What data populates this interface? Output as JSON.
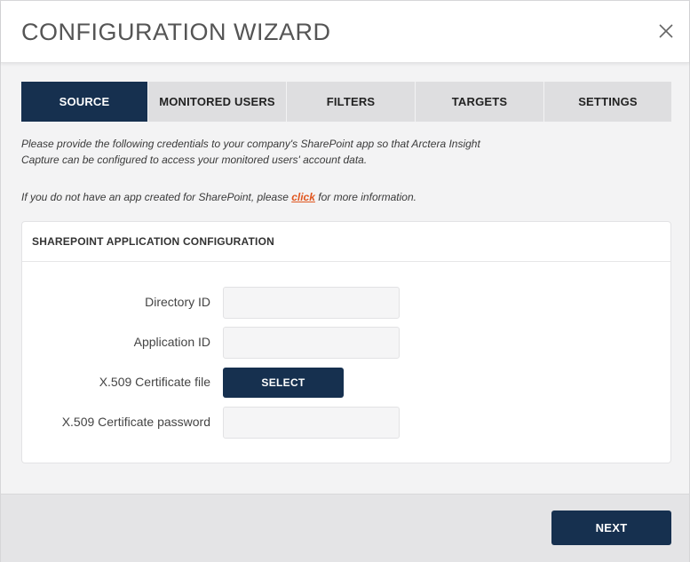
{
  "dialog": {
    "title": "CONFIGURATION WIZARD"
  },
  "tabs": [
    {
      "label": "SOURCE",
      "active": true
    },
    {
      "label": "MONITORED USERS",
      "active": false
    },
    {
      "label": "FILTERS",
      "active": false
    },
    {
      "label": "TARGETS",
      "active": false
    },
    {
      "label": "SETTINGS",
      "active": false
    }
  ],
  "intro": {
    "text": "Please provide the following credentials to your company's SharePoint app so that Arctera Insight Capture can be configured to access your monitored users' account data.",
    "hint_before": "If you do not have an app created for SharePoint, please ",
    "hint_link": "click",
    "hint_after": " for more information."
  },
  "card": {
    "heading": "SHAREPOINT APPLICATION CONFIGURATION",
    "fields": {
      "directory_id": {
        "label": "Directory ID",
        "value": ""
      },
      "application_id": {
        "label": "Application ID",
        "value": ""
      },
      "certificate_file": {
        "label": "X.509 Certificate file",
        "button": "SELECT"
      },
      "certificate_password": {
        "label": "X.509 Certificate password",
        "value": ""
      }
    }
  },
  "footer": {
    "next_label": "NEXT"
  },
  "colors": {
    "primary": "#16304f",
    "link": "#e0561f",
    "tab_inactive": "#dedee0"
  },
  "icons": {
    "close": "close-icon"
  }
}
